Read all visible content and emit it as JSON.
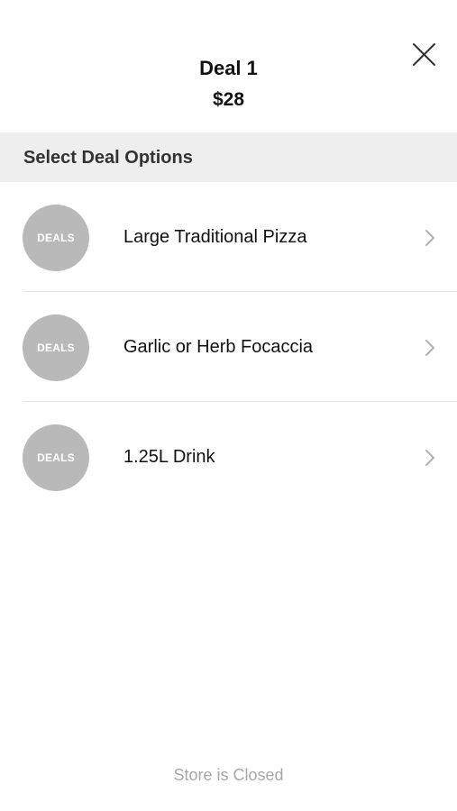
{
  "header": {
    "title": "Deal 1",
    "price": "$28"
  },
  "section": {
    "title": "Select Deal Options"
  },
  "options": [
    {
      "badge": "DEALS",
      "label": "Large Traditional Pizza"
    },
    {
      "badge": "DEALS",
      "label": "Garlic or Herb Focaccia"
    },
    {
      "badge": "DEALS",
      "label": "1.25L Drink"
    }
  ],
  "footer": {
    "status": "Store is Closed"
  },
  "icons": {
    "close": "close-icon",
    "chevron": "chevron-right-icon"
  },
  "colors": {
    "badge_background": "#b9b9b9",
    "section_background": "#eeeeee",
    "status_text": "#a8a8a8"
  }
}
